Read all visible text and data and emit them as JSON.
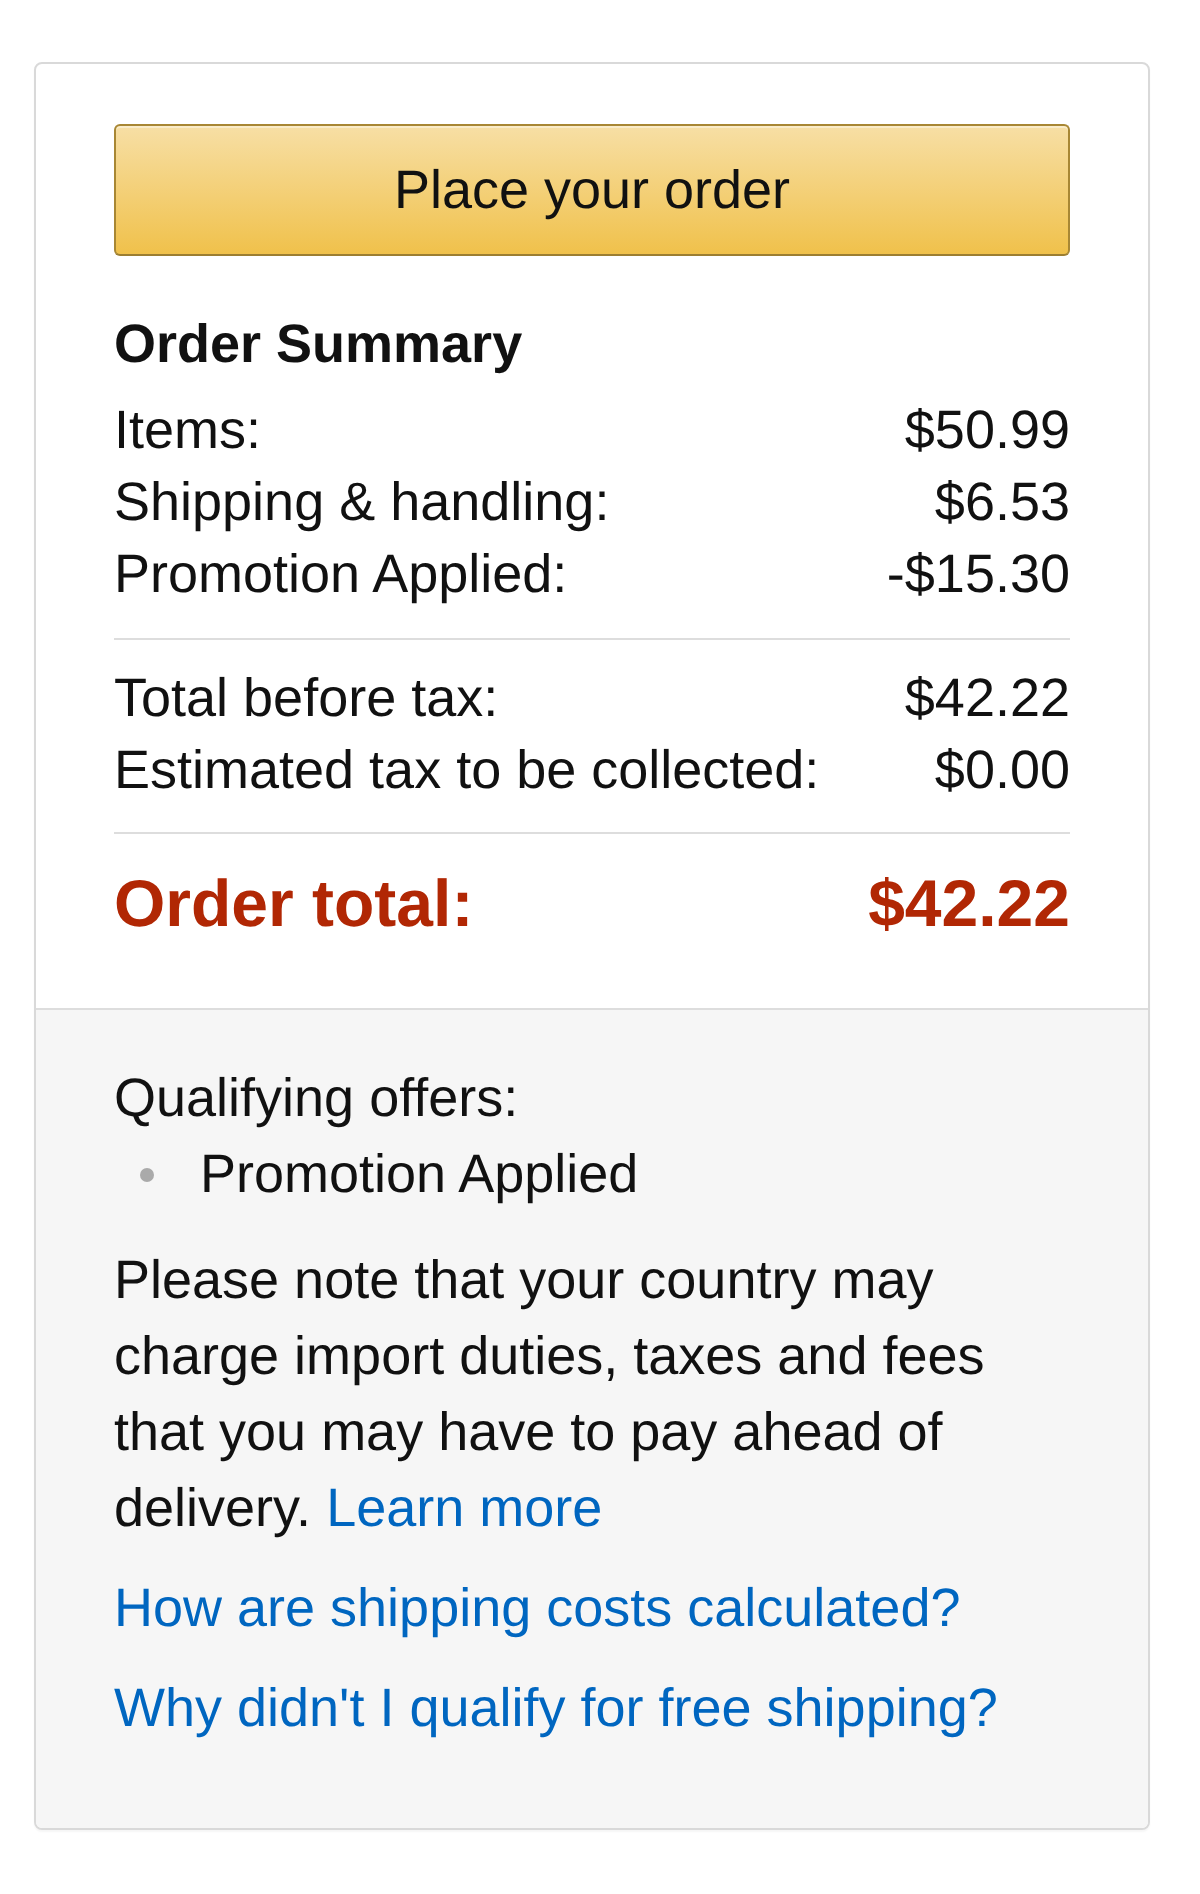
{
  "order_button": {
    "label": "Place your order"
  },
  "summary": {
    "title": "Order Summary",
    "groups": [
      {
        "rows": [
          {
            "label": "Items:",
            "amount": "$50.99"
          },
          {
            "label": "Shipping & handling:",
            "amount": "$6.53"
          },
          {
            "label": "Promotion Applied:",
            "amount": "-$15.30"
          }
        ]
      },
      {
        "rows": [
          {
            "label": "Total before tax:",
            "amount": "$42.22"
          },
          {
            "label": "Estimated tax to be collected:",
            "amount": "$0.00"
          }
        ]
      }
    ],
    "total": {
      "label": "Order total:",
      "amount": "$42.22"
    }
  },
  "info": {
    "offers_title": "Qualifying offers:",
    "offers": [
      "Promotion Applied"
    ],
    "note": {
      "text": "Please note that your country may charge import duties, taxes and fees that you may have to pay ahead of delivery.",
      "link": "Learn more"
    },
    "links": [
      "How are shipping costs calculated?",
      "Why didn't I qualify for free shipping?"
    ]
  }
}
